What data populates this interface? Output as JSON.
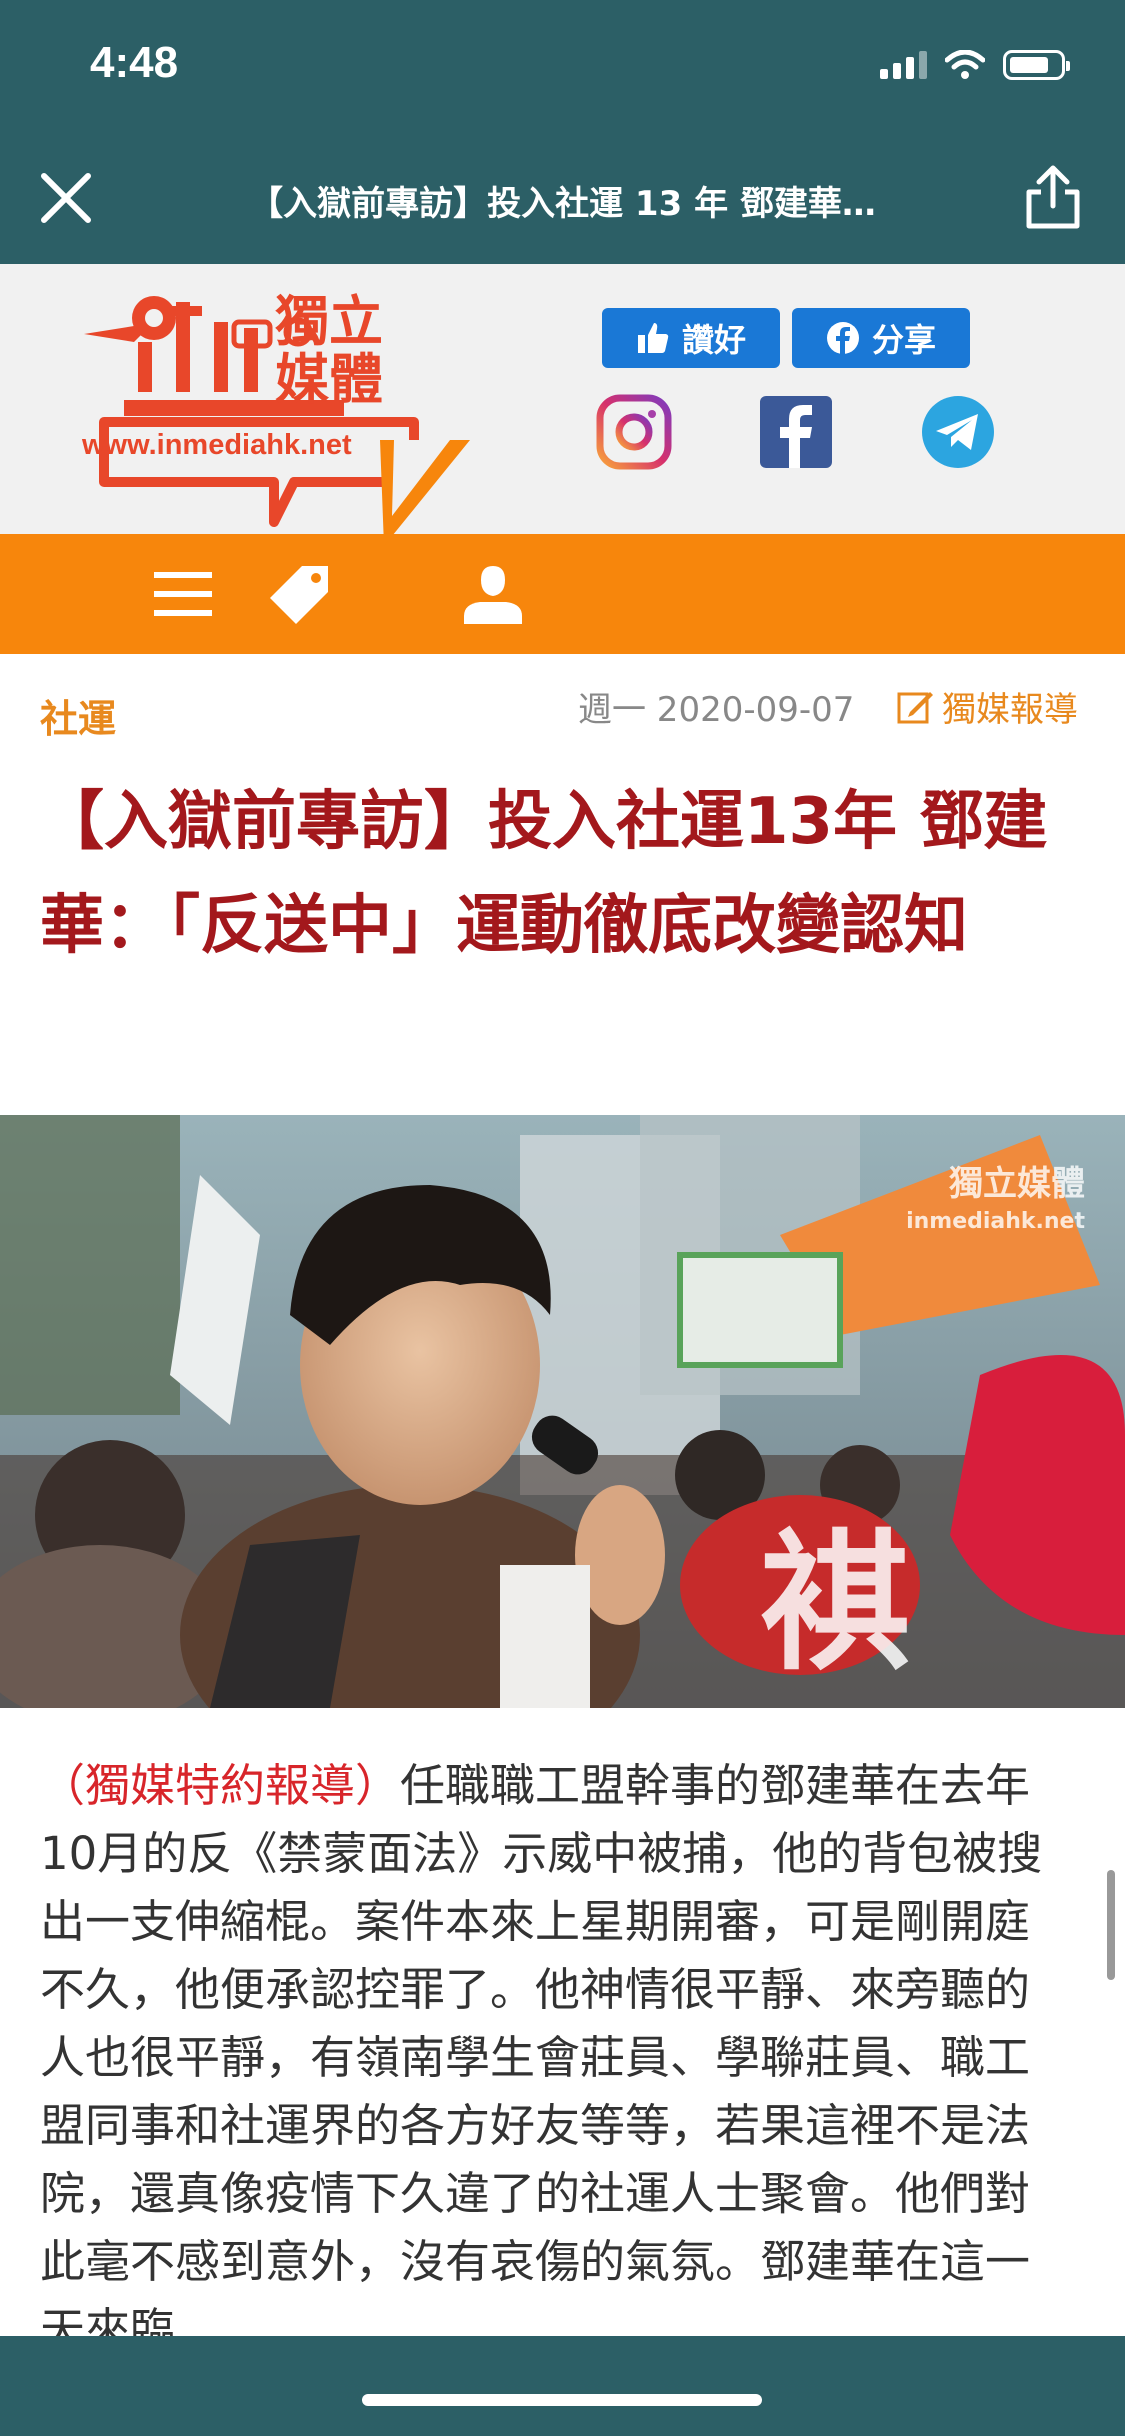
{
  "status_bar": {
    "time": "4:48",
    "battery_level": 0.75
  },
  "nav": {
    "title": "【入獄前專訪】投入社運 13 年 鄧建華…"
  },
  "site": {
    "logo_text": "獨立媒體",
    "logo_url": "www.inmediahk.net",
    "like_label": "讚好",
    "share_label": "分享"
  },
  "article": {
    "category": "社運",
    "date": "週一 2020-09-07",
    "author": "獨媒報導",
    "title": "【入獄前專訪】投入社運13年 鄧建華：「反送中」運動徹底改變認知",
    "lead": "（獨媒特約報導）",
    "body": "任職職工盟幹事的鄧建華在去年10月的反《禁蒙面法》示威中被捕，他的背包被搜出一支伸縮棍。案件本來上星期開審，可是剛開庭不久，他便承認控罪了。他神情很平靜、來旁聽的人也很平靜，有嶺南學生會莊員、學聯莊員、職工盟同事和社運界的各方好友等等，若果這裡不是法院，還真像疫情下久違了的社運人士聚會。他們對此毫不感到意外，沒有哀傷的氣氛。鄧建華在這一天來臨"
  },
  "hero_image": {
    "watermark": "獨立媒體",
    "watermark_url": "inmediahk.net",
    "banner_char": "褀"
  },
  "colors": {
    "nav": "#2c5f66",
    "orange": "#f7860c",
    "title_red": "#a3181c",
    "facebook": "#1a78d6"
  }
}
